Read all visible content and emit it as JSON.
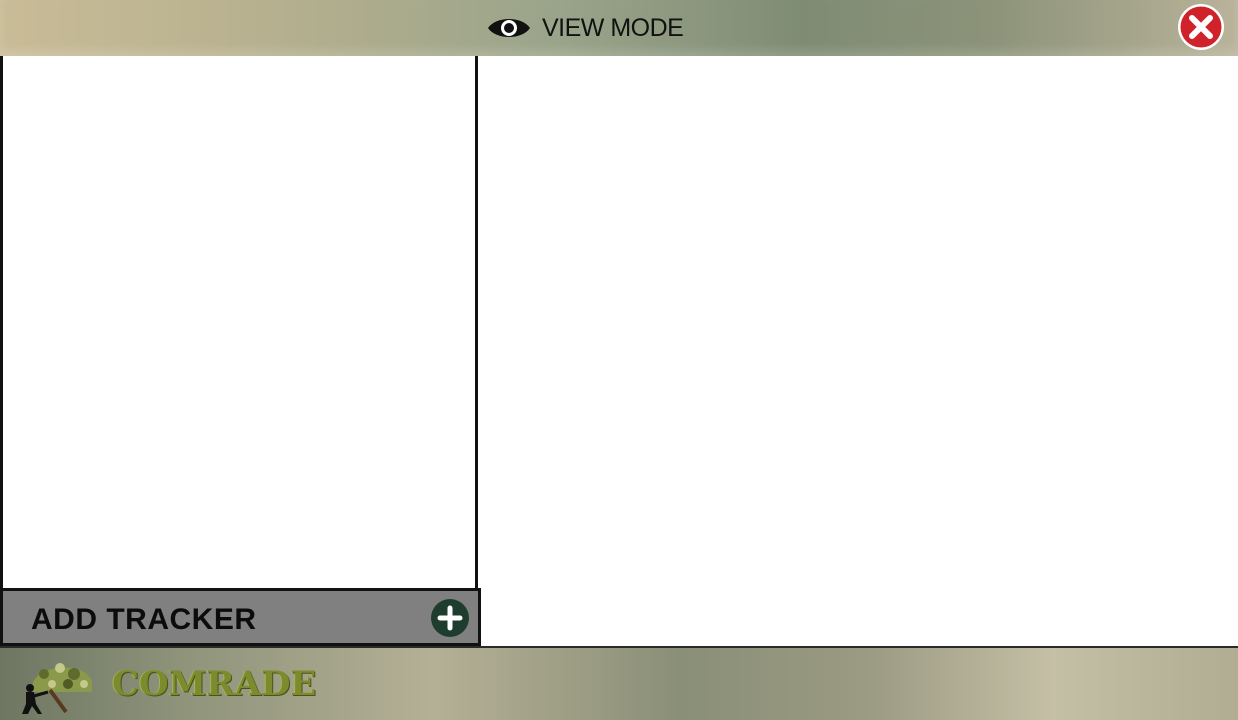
{
  "header": {
    "title": "VIEW MODE",
    "title_icon": "eye-icon",
    "close_icon": "close-icon",
    "close_color": "#d0222a"
  },
  "left_panel": {
    "add_tracker_label": "ADD TRACKER",
    "add_icon": "plus-circle-icon",
    "add_icon_color": "#1f3d2e"
  },
  "footer": {
    "logo_text": "COMRADE",
    "logo_icon": "soldier-helmet-logo",
    "logo_color": "#7c8b2e"
  }
}
